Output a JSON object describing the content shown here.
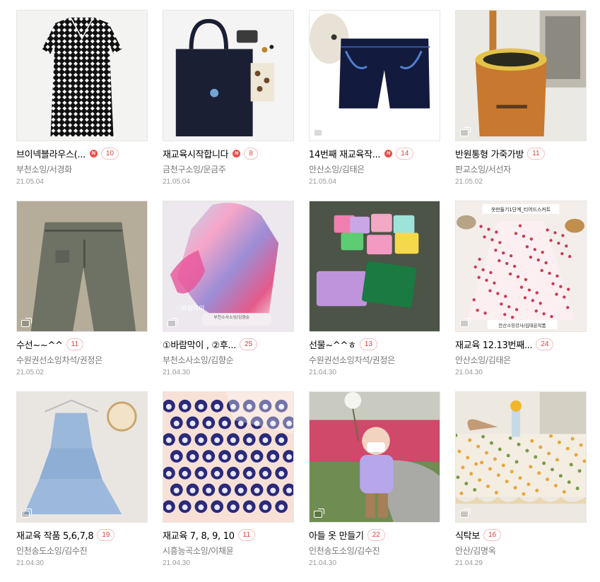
{
  "posts": [
    {
      "title": "브이넥블라우스(...",
      "is_new": true,
      "comment_count": "10",
      "author": "부천소잉/서경화",
      "date": "21.05.04",
      "has_gallery": false,
      "thumb": "dotted-blouse"
    },
    {
      "title": "재교육시작합니다",
      "is_new": true,
      "comment_count": "8",
      "author": "금천구소잉/문금주",
      "date": "21.05.04",
      "has_gallery": false,
      "thumb": "tote-bag"
    },
    {
      "title": "14번째 재교육작...",
      "is_new": true,
      "comment_count": "14",
      "author": "안산소잉/김태은",
      "date": "21.05.04",
      "has_gallery": true,
      "thumb": "navy-shorts"
    },
    {
      "title": "반원통형 가죽가방",
      "is_new": false,
      "comment_count": "11",
      "author": "판교소잉/서선자",
      "date": "21.05.02",
      "has_gallery": true,
      "thumb": "leather-bucket"
    },
    {
      "title": "수선~~^^",
      "is_new": false,
      "comment_count": "11",
      "author": "수원권선소잉차석/권정은",
      "date": "21.05.02",
      "has_gallery": true,
      "thumb": "khaki-pants"
    },
    {
      "title": "①바람막이 , ②후...",
      "is_new": false,
      "comment_count": "25",
      "author": "부천소사소잉/김향순",
      "date": "21.04.30",
      "has_gallery": true,
      "thumb": "rainbow-jacket"
    },
    {
      "title": "선물~^^ㅎ",
      "is_new": false,
      "comment_count": "13",
      "author": "수원권선소잉차석/권정은",
      "date": "21.04.30",
      "has_gallery": false,
      "thumb": "crochet-pouches"
    },
    {
      "title": "재교육 12.13번째...",
      "is_new": false,
      "comment_count": "24",
      "author": "안산소잉/김태은",
      "date": "21.04.30",
      "has_gallery": true,
      "thumb": "floral-skirt"
    },
    {
      "title": "재교육 작품 5,6,7,8",
      "is_new": false,
      "comment_count": "19",
      "author": "인천송도소잉/김수진",
      "date": "21.04.30",
      "has_gallery": true,
      "thumb": "blue-tiered-skirt"
    },
    {
      "title": "재교육 7, 8, 9, 10",
      "is_new": false,
      "comment_count": "11",
      "author": "시흥능곡소잉/이채윤",
      "date": "21.04.30",
      "has_gallery": false,
      "thumb": "bear-print-fabric"
    },
    {
      "title": "아들 옷 만들기",
      "is_new": false,
      "comment_count": "22",
      "author": "인천송도소잉/김수진",
      "date": "21.04.30",
      "has_gallery": true,
      "thumb": "boy-with-dandelion"
    },
    {
      "title": "식탁보",
      "is_new": false,
      "comment_count": "16",
      "author": "안산/김명옥",
      "date": "21.04.29",
      "has_gallery": true,
      "thumb": "floral-tablecloth"
    }
  ],
  "thumb_overlays": {
    "floral_skirt_top": "옷만들기1단계_티어드스커트",
    "floral_skirt_bottom": "안산소잉강사/김태은작품",
    "rainbow_jacket_tag": "바람막이",
    "rainbow_jacket_credit": "부천소사소잉/김향순"
  },
  "new_badge_label": "N",
  "colors": {
    "accent": "#ef4b46",
    "count_border": "#f2c1bf",
    "author": "#777777",
    "date": "#999999"
  }
}
